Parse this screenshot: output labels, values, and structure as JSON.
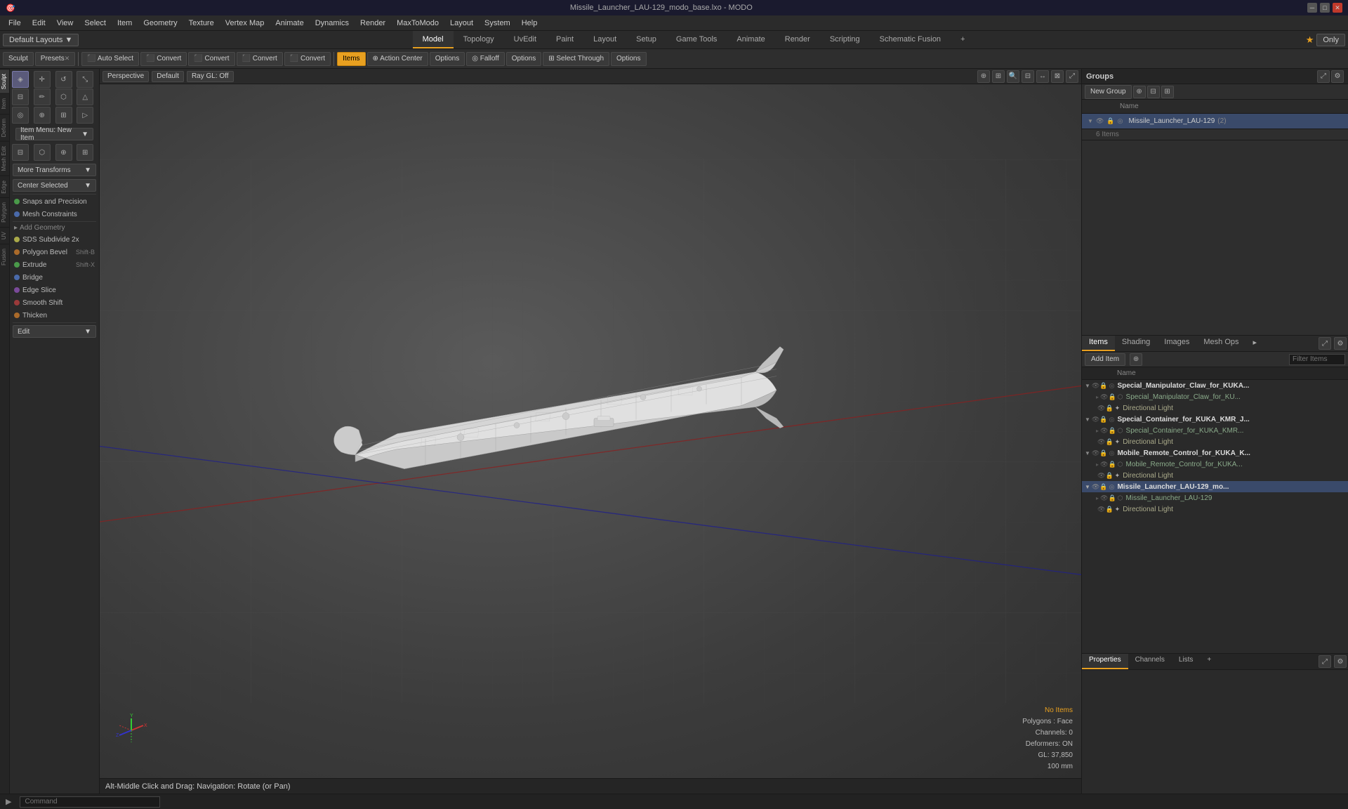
{
  "titlebar": {
    "title": "Missile_Launcher_LAU-129_modo_base.lxo - MODO",
    "icon": "🎯"
  },
  "menubar": {
    "items": [
      "File",
      "Edit",
      "View",
      "Select",
      "Item",
      "Geometry",
      "Texture",
      "Vertex Map",
      "Animate",
      "Dynamics",
      "Render",
      "MaxToModo",
      "Layout",
      "System",
      "Help"
    ]
  },
  "tabbar": {
    "layout_btn": "Default Layouts ▼",
    "tabs": [
      "Model",
      "Topology",
      "UvEdit",
      "Paint",
      "Layout",
      "Setup",
      "Game Tools",
      "Animate",
      "Render",
      "Scripting",
      "Schematic Fusion"
    ],
    "active_tab": "Model",
    "add_tab": "+",
    "star": "★",
    "only_btn": "Only"
  },
  "toolbar": {
    "sculpt_label": "Sculpt",
    "presets_label": "Presets",
    "presets_x": "✕",
    "auto_select": "Auto Select",
    "convert1": "Convert",
    "convert2": "Convert",
    "convert3": "Convert",
    "convert4": "Convert",
    "items_label": "Items",
    "action_center": "Action Center",
    "options1": "Options",
    "falloff": "Falloff",
    "options2": "Options",
    "select_through": "Select Through",
    "options3": "Options"
  },
  "viewport_header": {
    "perspective": "Perspective",
    "default": "Default",
    "ray_gl": "Ray GL: Off"
  },
  "left_panel": {
    "icon_tools": [
      "●",
      "○",
      "□",
      "△",
      "⬡",
      "⬡",
      "⬡",
      "⬡",
      "◎",
      "⌖",
      "⬜",
      "▷",
      "↺",
      "↻",
      "⊕",
      "⊗"
    ],
    "more_transforms": "More Transforms",
    "center_selected": "Center Selected",
    "snaps_precision": "Snaps and Precision",
    "mesh_constraints": "Mesh Constraints",
    "add_geometry": "Add Geometry",
    "sds_subdivide": "SDS Subdivide 2x",
    "polygon_bevel": "Polygon Bevel",
    "polygon_bevel_shortcut": "Shift-B",
    "extrude": "Extrude",
    "extrude_shortcut": "Shift-X",
    "bridge": "Bridge",
    "edge_slice": "Edge Slice",
    "smooth_shift": "Smooth Shift",
    "thicken": "Thicken",
    "edit_label": "Edit",
    "side_tabs": [
      "Sculpt",
      "Item",
      "Deform",
      "Mesh Edit",
      "Edge",
      "Polygon",
      "UV",
      "Fusion"
    ]
  },
  "groups_panel": {
    "title": "Groups",
    "new_group_label": "New Group",
    "name_header": "Name",
    "items": [
      {
        "name": "Missile_Launcher_LAU-129",
        "count": "2",
        "sub_items": 6,
        "expanded": true
      }
    ]
  },
  "items_panel": {
    "tabs": [
      "Items",
      "Shading",
      "Images",
      "Mesh Ops",
      "▸"
    ],
    "active_tab": "Items",
    "add_item": "Add Item",
    "filter": "Filter Items",
    "name_col": "Name",
    "items": [
      {
        "level": 0,
        "type": "folder",
        "name": "Special_Manipulator_Claw_for_KUKA...",
        "expanded": true,
        "visible": true
      },
      {
        "level": 1,
        "type": "mesh",
        "name": "Special_Manipulator_Claw_for_KU...",
        "visible": true
      },
      {
        "level": 1,
        "type": "light",
        "name": "Directional Light",
        "visible": true
      },
      {
        "level": 0,
        "type": "folder",
        "name": "Special_Container_for_KUKA_KMR_J...",
        "expanded": true,
        "visible": true
      },
      {
        "level": 1,
        "type": "mesh",
        "name": "Special_Container_for_KUKA_KMR...",
        "visible": true
      },
      {
        "level": 1,
        "type": "light",
        "name": "Directional Light",
        "visible": true
      },
      {
        "level": 0,
        "type": "folder",
        "name": "Mobile_Remote_Control_for_KUKA_K...",
        "expanded": true,
        "visible": true
      },
      {
        "level": 1,
        "type": "mesh",
        "name": "Mobile_Remote_Control_for_KUKA...",
        "visible": true
      },
      {
        "level": 1,
        "type": "light",
        "name": "Directional Light",
        "visible": true
      },
      {
        "level": 0,
        "type": "folder",
        "name": "Missile_Launcher_LAU-129_mo...",
        "expanded": true,
        "visible": true,
        "selected": true
      },
      {
        "level": 1,
        "type": "mesh",
        "name": "Missile_Launcher_LAU-129",
        "visible": true
      },
      {
        "level": 1,
        "type": "light",
        "name": "Directional Light",
        "visible": true
      }
    ]
  },
  "properties_panel": {
    "tabs": [
      "Properties",
      "Channels",
      "Lists"
    ],
    "active_tab": "Properties",
    "add_tab_icon": "+"
  },
  "viewport_info": {
    "no_items": "No Items",
    "polygons": "Polygons : Face",
    "channels": "Channels: 0",
    "deformers": "Deformers: ON",
    "gl": "GL: 37,850",
    "size": "100 mm"
  },
  "status_bar": {
    "hint": "Alt-Middle Click and Drag:  Navigation: Rotate (or Pan)"
  },
  "bottom_bar": {
    "triangle": "▶",
    "command_placeholder": "Command"
  }
}
